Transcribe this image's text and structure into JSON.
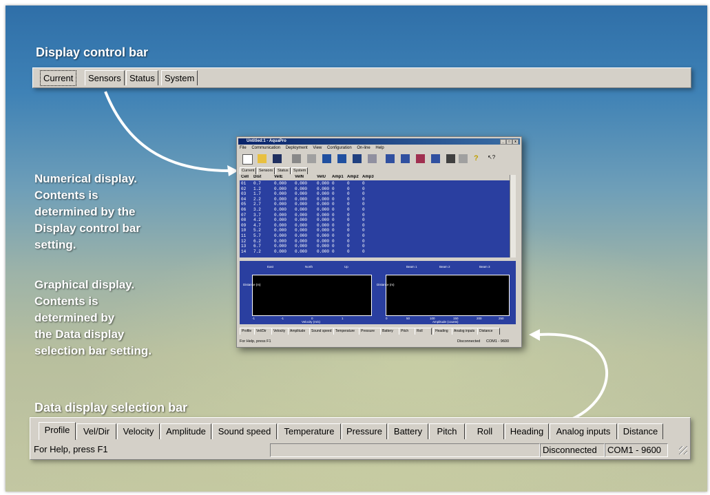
{
  "annotations": {
    "display_control_title": "Display control bar",
    "numerical": [
      "Numerical display.",
      "Contents is",
      "determined by the",
      "Display control bar",
      "setting."
    ],
    "graphical": [
      "Graphical display.",
      "Contents is",
      "determined by",
      "the Data display",
      "selection bar setting."
    ],
    "data_selection_title": "Data display selection bar"
  },
  "display_tabs": [
    "Current",
    "Sensors",
    "Status",
    "System"
  ],
  "display_active": "Current",
  "data_tabs": [
    "Profile",
    "Vel/Dir",
    "Velocity",
    "Amplitude",
    "Sound speed",
    "Temperature",
    "Pressure",
    "Battery",
    "Pitch",
    "Roll",
    "Heading",
    "Analog inputs",
    "Distance"
  ],
  "data_active": "Profile",
  "status": {
    "help": "For Help, press F1",
    "connection": "Disconnected",
    "port": "COM1 - 9600"
  },
  "mini_window": {
    "title": "Untitled:1 - AquaPro",
    "menu": [
      "File",
      "Communication",
      "Deployment",
      "View",
      "Configuration",
      "On-line",
      "Help"
    ],
    "table_headers": [
      "Cell",
      "Dist",
      "VelE",
      "VelN",
      "VelU",
      "Amp1",
      "Amp2",
      "Amp3"
    ],
    "rows": [
      [
        "01",
        "0.7",
        "0.000",
        "0.000",
        "0.000",
        "0",
        "0",
        "0"
      ],
      [
        "02",
        "1.2",
        "0.000",
        "0.000",
        "0.000",
        "0",
        "0",
        "0"
      ],
      [
        "03",
        "1.7",
        "0.000",
        "0.000",
        "0.000",
        "0",
        "0",
        "0"
      ],
      [
        "04",
        "2.2",
        "0.000",
        "0.000",
        "0.000",
        "0",
        "0",
        "0"
      ],
      [
        "05",
        "2.7",
        "0.000",
        "0.000",
        "0.000",
        "0",
        "0",
        "0"
      ],
      [
        "06",
        "3.2",
        "0.000",
        "0.000",
        "0.000",
        "0",
        "0",
        "0"
      ],
      [
        "07",
        "3.7",
        "0.000",
        "0.000",
        "0.000",
        "0",
        "0",
        "0"
      ],
      [
        "08",
        "4.2",
        "0.000",
        "0.000",
        "0.000",
        "0",
        "0",
        "0"
      ],
      [
        "09",
        "4.7",
        "0.000",
        "0.000",
        "0.000",
        "0",
        "0",
        "0"
      ],
      [
        "10",
        "5.2",
        "0.000",
        "0.000",
        "0.000",
        "0",
        "0",
        "0"
      ],
      [
        "11",
        "5.7",
        "0.000",
        "0.000",
        "0.000",
        "0",
        "0",
        "0"
      ],
      [
        "12",
        "6.2",
        "0.000",
        "0.000",
        "0.000",
        "0",
        "0",
        "0"
      ],
      [
        "13",
        "6.7",
        "0.000",
        "0.000",
        "0.000",
        "0",
        "0",
        "0"
      ],
      [
        "14",
        "7.2",
        "0.000",
        "0.000",
        "0.000",
        "0",
        "0",
        "0"
      ]
    ],
    "graph_left_legend": [
      "East",
      "North",
      "Up"
    ],
    "graph_right_legend": [
      "Beam 1",
      "Beam 2",
      "Beam 3"
    ],
    "graph_left_xlabel": "Velocity (m/s)",
    "graph_right_xlabel": "Amplitude (counts)",
    "ylabel": "Distance (m)",
    "left_xticks": [
      "-1",
      "-1",
      "0",
      "1"
    ],
    "right_xticks": [
      "0",
      "50",
      "100",
      "150",
      "200",
      "250"
    ],
    "help": "For Help, press F1",
    "connection": "Disconnected",
    "port": "COM1 - 9600"
  }
}
